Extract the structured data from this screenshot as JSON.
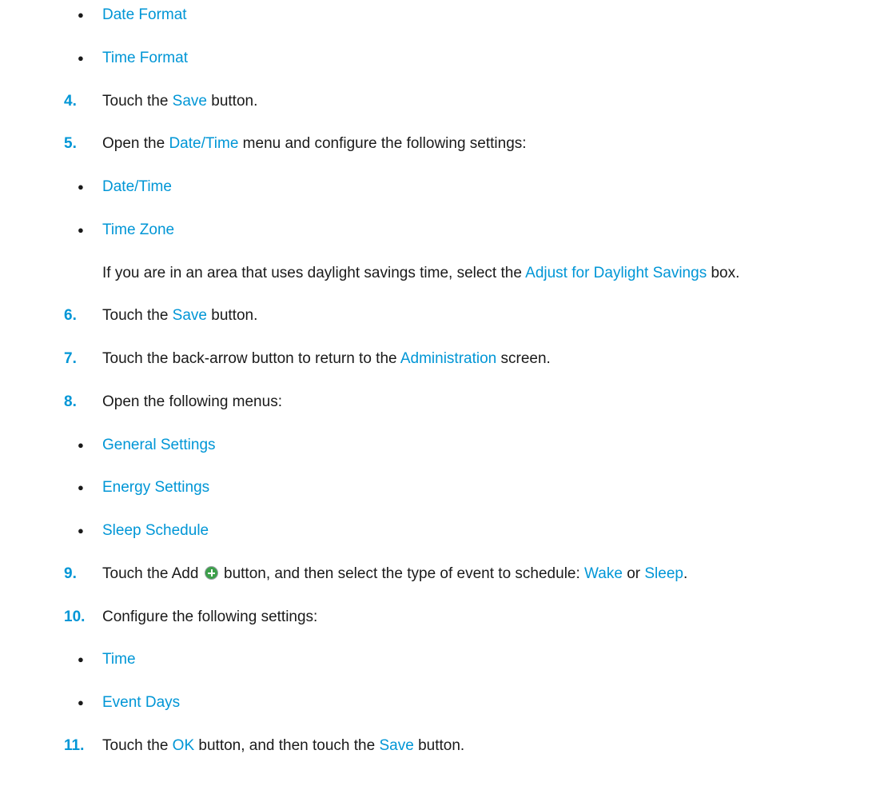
{
  "colors": {
    "accent": "#0096d6",
    "text": "#1a1a1a",
    "icon_green": "#3c9f4a"
  },
  "bullet_char": "●",
  "bullets_top": [
    {
      "label": "Date Format"
    },
    {
      "label": "Time Format"
    }
  ],
  "step4": {
    "num": "4.",
    "pre": "Touch the ",
    "ui": "Save",
    "post": " button."
  },
  "step5": {
    "num": "5.",
    "pre": "Open the ",
    "ui": "Date/Time",
    "post": " menu and configure the following settings:"
  },
  "bullets_5": [
    {
      "label": "Date/Time"
    },
    {
      "label": "Time Zone"
    }
  ],
  "note5": {
    "pre": "If you are in an area that uses daylight savings time, select the ",
    "ui": "Adjust for Daylight Savings",
    "post": " box."
  },
  "step6": {
    "num": "6.",
    "pre": "Touch the ",
    "ui": "Save",
    "post": " button."
  },
  "step7": {
    "num": "7.",
    "pre": "Touch the back-arrow button to return to the ",
    "ui": "Administration",
    "post": " screen."
  },
  "step8": {
    "num": "8.",
    "text": "Open the following menus:"
  },
  "bullets_8": [
    {
      "label": "General Settings"
    },
    {
      "label": "Energy Settings"
    },
    {
      "label": "Sleep Schedule"
    }
  ],
  "step9": {
    "num": "9.",
    "pre": "Touch the Add ",
    "icon": "add-icon",
    "mid": " button, and then select the type of event to schedule: ",
    "ui1": "Wake",
    "or": " or ",
    "ui2": "Sleep",
    "post": "."
  },
  "step10": {
    "num": "10.",
    "text": "Configure the following settings:"
  },
  "bullets_10": [
    {
      "label": "Time"
    },
    {
      "label": "Event Days"
    }
  ],
  "step11": {
    "num": "11.",
    "pre": "Touch the ",
    "ui1": "OK",
    "mid": " button, and then touch the ",
    "ui2": "Save",
    "post": " button."
  }
}
